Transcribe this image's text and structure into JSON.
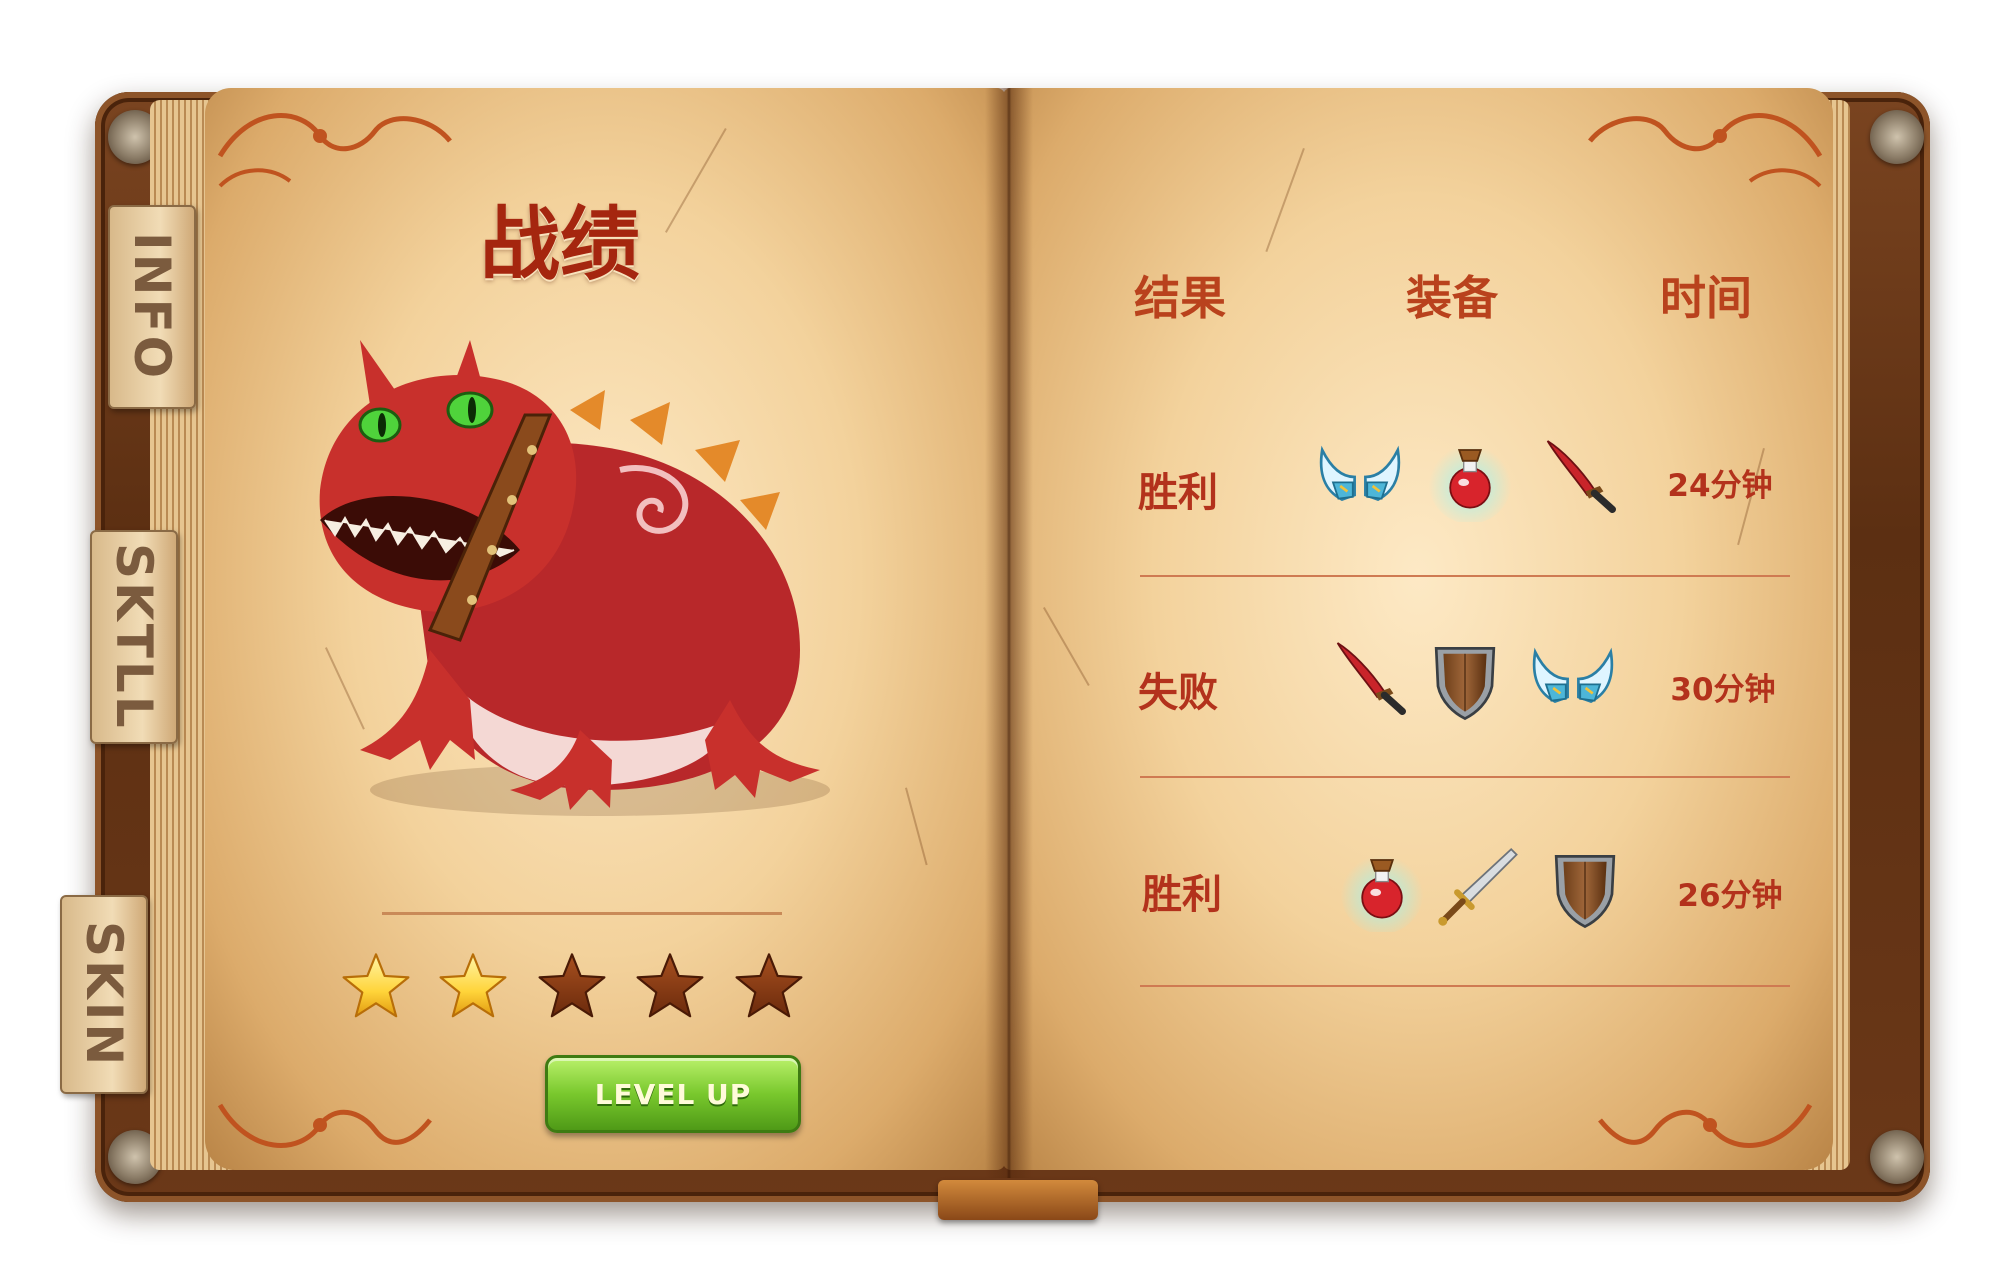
{
  "side_tabs": [
    {
      "label": "INFO"
    },
    {
      "label": "SKTLL"
    },
    {
      "label": "SKIN"
    }
  ],
  "left_page": {
    "title": "战绩",
    "monster_icon": "red-toad-monster",
    "star_rating": {
      "filled": 2,
      "total": 5
    },
    "level_up_label": "LEVEL UP"
  },
  "right_page": {
    "headers": {
      "result": "结果",
      "equipment": "装备",
      "time": "时间"
    },
    "rows": [
      {
        "result": "胜利",
        "equipment": [
          "horned-helmet",
          "red-potion",
          "red-scimitar"
        ],
        "time": "24分钟"
      },
      {
        "result": "失败",
        "equipment": [
          "red-scimitar",
          "wooden-shield",
          "horned-helmet"
        ],
        "time": "30分钟"
      },
      {
        "result": "胜利",
        "equipment": [
          "red-potion",
          "steel-sword",
          "wooden-shield"
        ],
        "time": "26分钟"
      }
    ]
  },
  "colors": {
    "title_red": "#a5260f",
    "header_orange": "#b9421d",
    "text_red": "#b3321c",
    "button_green": "#79c82d",
    "star_gold": "#ffd43a",
    "star_empty": "#8a3a14",
    "parchment": "#f3d29c"
  }
}
